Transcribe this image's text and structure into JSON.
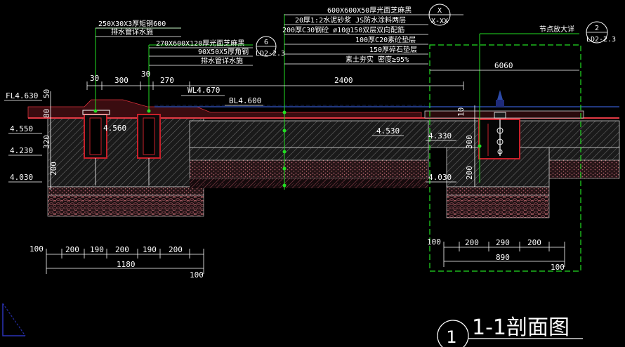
{
  "colors": {
    "background": "#000000",
    "text": "#ffffff",
    "leader_green": "#22dd22",
    "pavement_red": "#b02a26",
    "paving_surface": "#d8303a",
    "water_blue": "#2c4aa8",
    "hatch_gray": "#9a9a9a",
    "gravel_pink": "#a85a6a",
    "steel_red": "#c8202a",
    "corner_icon": "#2a32b8"
  },
  "notes": {
    "left_1": "250X30X3厚矩钢600",
    "left_2": "排水管详水施",
    "mid_1": "270X600X120厚光面芝麻黑",
    "mid_2": "90X50X5厚角钢",
    "mid_3": "排水管详水施",
    "top_1": "600X600X50厚光面芝麻黑",
    "top_2": "20厚1:2水泥砂浆 JS防水涂料两层",
    "top_3": "200厚C30钢砼 ø10@150双层双向配筋",
    "top_4": "100厚C20素砼垫层",
    "top_5": "150厚碎石垫层",
    "top_6": "素土夯实 密度≥95%"
  },
  "callouts": {
    "ref_x_top": "X",
    "ref_x_bottom": "X-XX",
    "ref_6_top": "6",
    "ref_6_bottom": "LD2-2.3",
    "detail_label": "节点放大详",
    "ref_2_top": "2",
    "ref_2_bottom": "LD2-2.3"
  },
  "dims_top": {
    "d30a": "30",
    "d300": "300",
    "d30b": "30",
    "d270": "270",
    "d2400": "2400",
    "d6060": "6060"
  },
  "levels": {
    "fl": "FL4.630",
    "wl": "WL4.670",
    "bl": "BL4.600",
    "l4550": "4.550",
    "l4560": "4.560",
    "l4230": "4.230",
    "l4030": "4.030",
    "l4530": "4.530",
    "l4330": "4.330",
    "l4030r": "4.030"
  },
  "dims_left_vertical": {
    "v50": "50",
    "v80": "80",
    "v320": "320",
    "v200": "200"
  },
  "dims_right_vertical": {
    "v10": "10",
    "v300": "300",
    "v200": "200"
  },
  "dims_bottom_left": {
    "d100a": "100",
    "d200a": "200",
    "d190a": "190",
    "d200b": "200",
    "d190b": "190",
    "d200c": "200",
    "total": "1180",
    "d100b": "100"
  },
  "dims_bottom_right": {
    "d100a": "100",
    "d200a": "200",
    "d290": "290",
    "d200b": "200",
    "total": "890",
    "d100b": "100"
  },
  "title": {
    "number": "1",
    "text": "1-1剖面图"
  }
}
